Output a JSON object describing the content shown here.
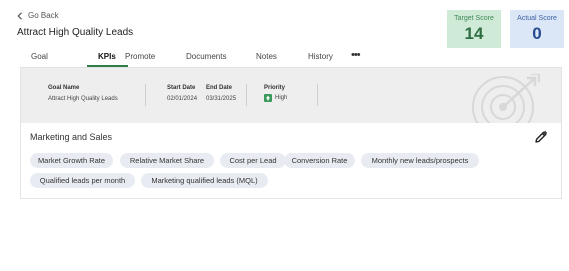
{
  "header": {
    "back_label": "Go Back",
    "title": "Attract High Quality Leads"
  },
  "scores": {
    "target_label": "Target Score",
    "target_value": "14",
    "actual_label": "Actual Score",
    "actual_value": "0"
  },
  "tabs": [
    {
      "label": "Goal"
    },
    {
      "label": "KPIs",
      "active": true
    },
    {
      "label": "Promote"
    },
    {
      "label": "Documents"
    },
    {
      "label": "Notes"
    },
    {
      "label": "History"
    }
  ],
  "more_label": "•••",
  "goal_info": {
    "goal_name_label": "Goal Name",
    "goal_name_value": "Attract High Quality Leads",
    "start_date_label": "Start Date",
    "start_date_value": "02/01/2024",
    "end_date_label": "End Date",
    "end_date_value": "03/31/2025",
    "priority_label": "Priority",
    "priority_value": "High"
  },
  "kpi_section": {
    "title": "Marketing and Sales",
    "chips": [
      "Market Growth Rate",
      "Relative Market Share",
      "Cost per Lead",
      "Conversion Rate",
      "Monthly new leads/prospects",
      "Qualified leads per month",
      "Marketing qualified leads (MQL)"
    ]
  },
  "colors": {
    "accent_green": "#2f7d46",
    "target_bg": "#cfead7",
    "actual_bg": "#dbe6f7",
    "chip_bg": "#e8ecf2",
    "info_bg": "#eeeeee"
  },
  "icons": [
    "chevron-left-icon",
    "more-horizontal-icon",
    "arrow-up-icon",
    "target-icon",
    "pencil-icon"
  ]
}
